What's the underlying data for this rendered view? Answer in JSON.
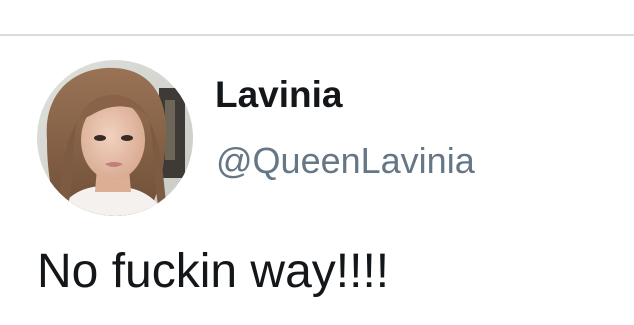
{
  "tweet": {
    "author": {
      "display_name": "Lavinia",
      "handle": "@QueenLavinia"
    },
    "text": "No fuckin way!!!!"
  },
  "colors": {
    "divider": "#d9dcdf",
    "primary_text": "#14171a",
    "secondary_text": "#657786",
    "background": "#ffffff"
  }
}
